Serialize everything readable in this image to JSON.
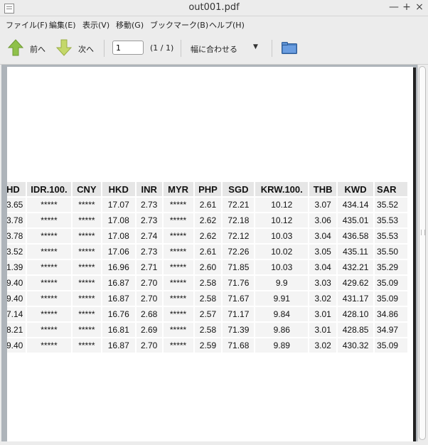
{
  "window": {
    "title": "out001.pdf",
    "minimize": "—",
    "maximize": "+",
    "close": "×"
  },
  "menu": [
    "ファイル(F)",
    "編集(E)",
    "表示(V)",
    "移動(G)",
    "ブックマーク(B)",
    "ヘルプ(H)"
  ],
  "toolbar": {
    "prev_label": "前へ",
    "next_label": "次へ",
    "page_value": "1",
    "page_count": "(1 / 1)",
    "zoom_label": "幅に合わせる",
    "zoom_arrow": "▼"
  },
  "colors": {
    "arrow_green": "#8fc14a",
    "folder_blue": "#4a7fc1"
  },
  "table": {
    "headers": [
      "HD",
      "IDR.100.",
      "CNY",
      "HKD",
      "INR",
      "MYR",
      "PHP",
      "SGD",
      "KRW.100.",
      "THB",
      "KWD",
      "SAR"
    ],
    "rows": [
      [
        "3.65",
        "*****",
        "*****",
        "17.07",
        "2.73",
        "*****",
        "2.61",
        "72.21",
        "10.12",
        "3.07",
        "434.14",
        "35.52"
      ],
      [
        "3.78",
        "*****",
        "*****",
        "17.08",
        "2.73",
        "*****",
        "2.62",
        "72.18",
        "10.12",
        "3.06",
        "435.01",
        "35.53"
      ],
      [
        "3.78",
        "*****",
        "*****",
        "17.08",
        "2.74",
        "*****",
        "2.62",
        "72.12",
        "10.03",
        "3.04",
        "436.58",
        "35.53"
      ],
      [
        "3.52",
        "*****",
        "*****",
        "17.06",
        "2.73",
        "*****",
        "2.61",
        "72.26",
        "10.02",
        "3.05",
        "435.11",
        "35.50"
      ],
      [
        "1.39",
        "*****",
        "*****",
        "16.96",
        "2.71",
        "*****",
        "2.60",
        "71.85",
        "10.03",
        "3.04",
        "432.21",
        "35.29"
      ],
      [
        "9.40",
        "*****",
        "*****",
        "16.87",
        "2.70",
        "*****",
        "2.58",
        "71.76",
        "9.9",
        "3.03",
        "429.62",
        "35.09"
      ],
      [
        "9.40",
        "*****",
        "*****",
        "16.87",
        "2.70",
        "*****",
        "2.58",
        "71.67",
        "9.91",
        "3.02",
        "431.17",
        "35.09"
      ],
      [
        "7.14",
        "*****",
        "*****",
        "16.76",
        "2.68",
        "*****",
        "2.57",
        "71.17",
        "9.84",
        "3.01",
        "428.10",
        "34.86"
      ],
      [
        "8.21",
        "*****",
        "*****",
        "16.81",
        "2.69",
        "*****",
        "2.58",
        "71.39",
        "9.86",
        "3.01",
        "428.85",
        "34.97"
      ],
      [
        "9.40",
        "*****",
        "*****",
        "16.87",
        "2.70",
        "*****",
        "2.59",
        "71.68",
        "9.89",
        "3.02",
        "430.32",
        "35.09"
      ]
    ]
  }
}
